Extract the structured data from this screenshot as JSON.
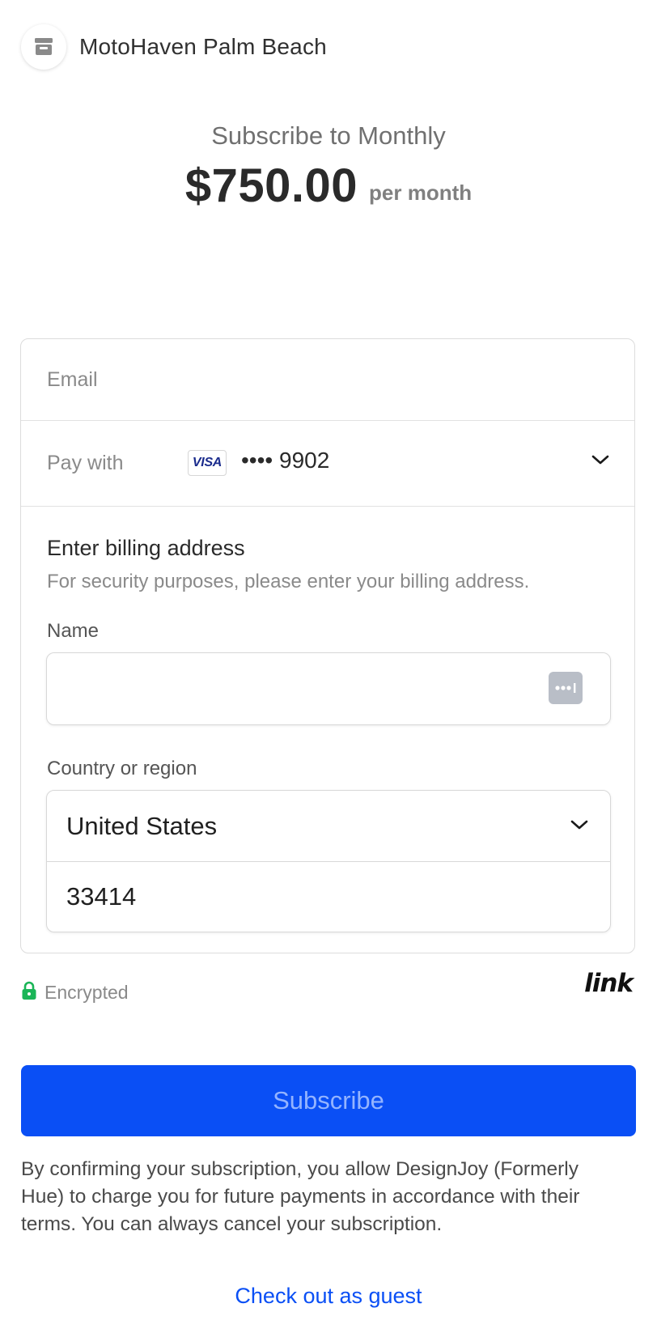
{
  "merchant": {
    "name": "MotoHaven Palm Beach",
    "logo_icon": "storefront-icon"
  },
  "summary": {
    "title": "Subscribe to Monthly",
    "amount": "$750.00",
    "period": "per month"
  },
  "form": {
    "email": {
      "label": "Email",
      "value": ""
    },
    "pay_with": {
      "label": "Pay with",
      "card_brand": "VISA",
      "card_masked": "•••• 9902"
    },
    "billing": {
      "title": "Enter billing address",
      "subtitle": "For security purposes, please enter your billing address.",
      "name_label": "Name",
      "name_value": "",
      "country_label": "Country or region",
      "country_value": "United States",
      "postal_value": "33414"
    }
  },
  "security": {
    "encrypted_label": "Encrypted",
    "link_brand": "link"
  },
  "actions": {
    "subscribe_label": "Subscribe",
    "terms": "By confirming your subscription, you allow DesignJoy (Formerly Hue) to charge you for future payments in accordance with their terms. You can always cancel your subscription.",
    "guest_label": "Check out as guest"
  },
  "colors": {
    "primary": "#0a4ff5",
    "lock_green": "#1ab557"
  }
}
